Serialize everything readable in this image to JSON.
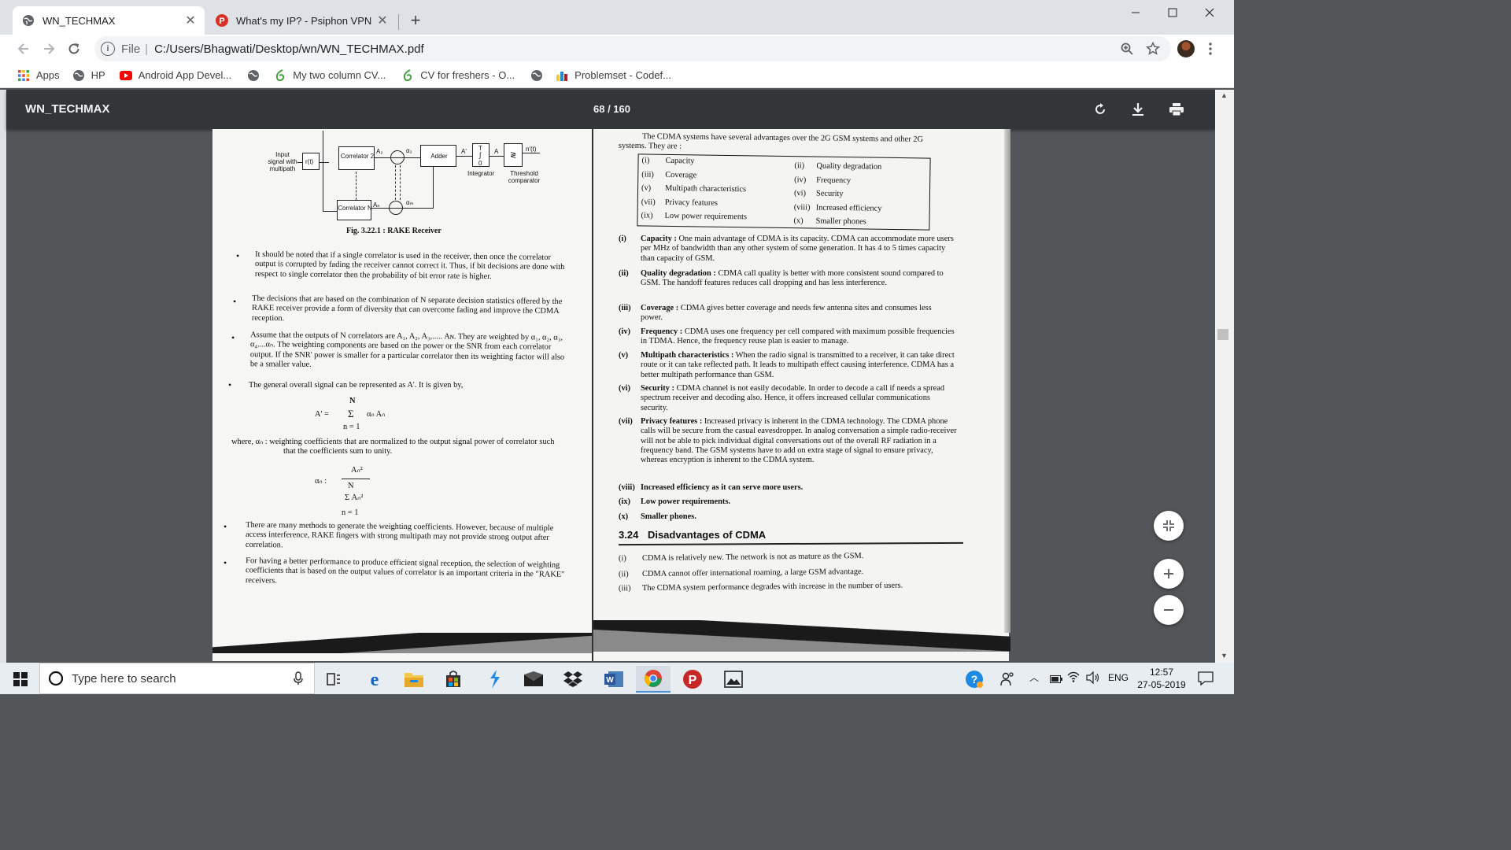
{
  "browser": {
    "tabs": [
      {
        "title": "WN_TECHMAX",
        "icon": "globe-icon",
        "active": true
      },
      {
        "title": "What's my IP? - Psiphon VPN",
        "icon": "psiphon-icon",
        "active": false
      }
    ],
    "new_tab_label": "+",
    "address": {
      "scheme": "File",
      "separator": "|",
      "url": "C:/Users/Bhagwati/Desktop/wn/WN_TECHMAX.pdf"
    },
    "bookmarks": [
      {
        "label": "Apps",
        "icon": "apps-grid-icon"
      },
      {
        "label": "HP",
        "icon": "globe-icon"
      },
      {
        "label": "Android App Devel...",
        "icon": "youtube-icon"
      },
      {
        "label": "",
        "icon": "globe-icon"
      },
      {
        "label": "My two column CV...",
        "icon": "overleaf-icon"
      },
      {
        "label": "CV for freshers - O...",
        "icon": "overleaf-icon"
      },
      {
        "label": "",
        "icon": "globe-icon"
      },
      {
        "label": "Problemset - Codef...",
        "icon": "codeforces-icon"
      }
    ]
  },
  "pdf": {
    "title": "WN_TECHMAX",
    "page_indicator": "68 / 160",
    "left": {
      "fig_labels": {
        "input": "Input signal with multipath",
        "rt": "r(t)",
        "corr2": "Correlator 2",
        "corrN": "Correlator N",
        "a2": "A₂",
        "an": "Aₙ",
        "alpha2": "α₂",
        "alpham": "αₘ",
        "adder": "Adder",
        "aprime": "A'",
        "integrator": "Integrator",
        "a": "A",
        "threshold": "Threshold comparator",
        "output": "n'(t)",
        "t_upper": "T",
        "t_lower": "0"
      },
      "fig_caption": "Fig. 3.22.1 : RAKE Receiver",
      "bullets": [
        "It should be noted that if a single correlator is used in the receiver, then once the correlator output is corrupted by fading the receiver cannot correct it. Thus, if bit decisions are done with respect to single correlator then the probability of bit error rate is higher.",
        "The decisions that are based on the combination of N separate decision statistics offered by the RAKE receiver provide a form of diversity that can overcome fading and improve the CDMA reception.",
        "Assume that the outputs of N correlators are A₁, A₂, A₃,..... Aɴ. They are weighted by α₁, α₂, α₃, α₄....αₙ. The weighting components are based on the power or the SNR from each correlator output. If the SNR' power is smaller for a particular correlator then its weighting factor will also be a smaller value.",
        "The general overall signal can be represented as A'. It is given by,"
      ],
      "eq1": {
        "upper": "N",
        "lhs": "A' =",
        "sum": "Σ",
        "term": "αₙ Aₙ",
        "lower": "n = 1"
      },
      "where_text": "where,  αₙ  : weighting coefficients that are normalized to the output signal power of correlator such that the coefficients sum to unity.",
      "eq2": {
        "lhs": "αₙ :",
        "num": "Aₙ²",
        "den_top": "N",
        "den_sum": "Σ Aₙ²",
        "den_bottom": "n = 1"
      },
      "bullets2": [
        "There are many methods to generate the weighting coefficients. However, because of multiple access interference, RAKE fingers with strong multipath may not provide strong output after correlation.",
        "For having a better performance to produce efficient signal reception, the selection of weighting coefficients that is based on the output values of correlator is an important criteria in the \"RAKE\" receivers."
      ]
    },
    "right": {
      "intro": "The CDMA systems have several advantages over the 2G GSM systems and other 2G systems. They are :",
      "adv_table": [
        [
          "(i)",
          "Capacity",
          "(ii)",
          "Quality degradation"
        ],
        [
          "(iii)",
          "Coverage",
          "(iv)",
          "Frequency"
        ],
        [
          "(v)",
          "Multipath characteristics",
          "(vi)",
          "Security"
        ],
        [
          "(vii)",
          "Privacy features",
          "(viii)",
          "Increased efficiency"
        ],
        [
          "(ix)",
          "Low power requirements",
          "(x)",
          "Smaller phones"
        ]
      ],
      "items": [
        {
          "num": "(i)",
          "head": "Capacity :",
          "text": "One main advantage of CDMA is its capacity. CDMA can accommodate more users per MHz of bandwidth than any other system of some generation. It has 4 to 5 times capacity than capacity of GSM."
        },
        {
          "num": "(ii)",
          "head": "Quality degradation :",
          "text": "CDMA call quality is better with more consistent sound compared to GSM. The handoff features reduces call dropping and has less interference."
        },
        {
          "num": "(iii)",
          "head": "Coverage :",
          "text": "CDMA gives better coverage and needs few antenna sites and consumes less power."
        },
        {
          "num": "(iv)",
          "head": "Frequency :",
          "text": "CDMA uses one frequency per cell compared with maximum possible frequencies in TDMA. Hence, the frequency reuse plan is easier to manage."
        },
        {
          "num": "(v)",
          "head": "Multipath characteristics :",
          "text": "When the radio signal is transmitted to a receiver, it can take direct route or it can take reflected path. It leads to multipath effect causing interference. CDMA has a better multipath performance than GSM."
        },
        {
          "num": "(vi)",
          "head": "Security :",
          "text": "CDMA channel is not easily decodable. In order to decode a call if needs a spread spectrum receiver and decoding also. Hence, it offers increased cellular communications security."
        },
        {
          "num": "(vii)",
          "head": "Privacy features :",
          "text": "Increased privacy is inherent in the CDMA technology. The CDMA phone calls will be secure from the casual eavesdropper. In analog conversation a simple radio-receiver will not be able to pick individual digital conversations out of the overall RF radiation in a frequency band. The GSM systems have to add on extra stage of signal to ensure privacy, whereas encryption is inherent to the CDMA system."
        },
        {
          "num": "(viii)",
          "head": "Increased efficiency as it can serve more users.",
          "text": ""
        },
        {
          "num": "(ix)",
          "head": "Low power requirements.",
          "text": ""
        },
        {
          "num": "(x)",
          "head": "Smaller phones.",
          "text": ""
        }
      ],
      "section": {
        "num": "3.24",
        "title": "Disadvantages of CDMA"
      },
      "disadvantages": [
        {
          "num": "(i)",
          "text": "CDMA is relatively new. The network is not as mature as the GSM."
        },
        {
          "num": "(ii)",
          "text": "CDMA cannot offer international roaming, a large GSM advantage."
        },
        {
          "num": "(iii)",
          "text": "The CDMA system performance degrades with increase in the number of users."
        }
      ]
    }
  },
  "taskbar": {
    "search_placeholder": "Type here to search",
    "language": "ENG",
    "time": "12:57",
    "date": "27-05-2019"
  }
}
